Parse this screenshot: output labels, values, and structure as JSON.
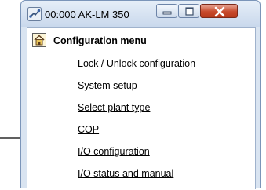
{
  "window": {
    "title": "00:000 AK-LM 350",
    "close_color": "#c84a2c"
  },
  "menu": {
    "title": "Configuration menu",
    "items": [
      {
        "label": "Lock / Unlock configuration"
      },
      {
        "label": "System setup"
      },
      {
        "label": "Select plant type"
      },
      {
        "label": "COP"
      },
      {
        "label": "I/O configuration"
      },
      {
        "label": "I/O status and manual"
      }
    ]
  },
  "icons": {
    "app": "network-plug-icon",
    "home": "home-icon",
    "pointer": "arrow-right-icon"
  }
}
